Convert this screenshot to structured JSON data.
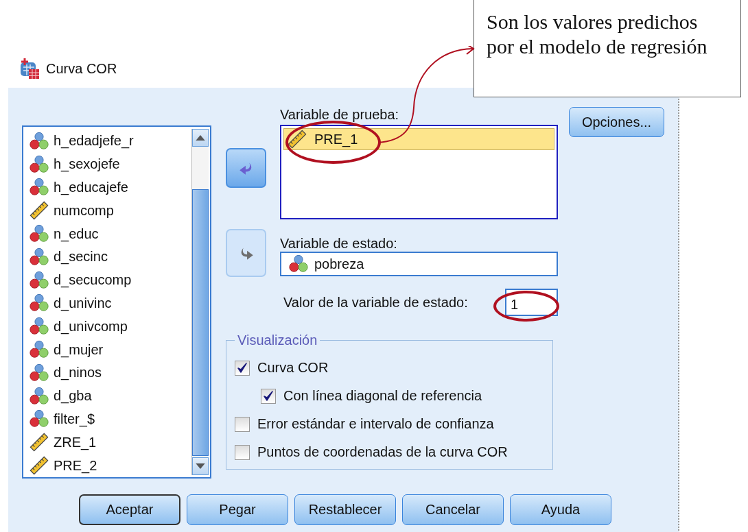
{
  "window": {
    "title": "Curva COR"
  },
  "annotation": {
    "text": "Son los valores predichos por el modelo de regresión"
  },
  "variables": [
    {
      "name": "h_edadjefe_r",
      "kind": "nominal"
    },
    {
      "name": "h_sexojefe",
      "kind": "nominal"
    },
    {
      "name": "h_educajefe",
      "kind": "nominal"
    },
    {
      "name": "numcomp",
      "kind": "scale"
    },
    {
      "name": "n_educ",
      "kind": "nominal"
    },
    {
      "name": "d_secinc",
      "kind": "nominal"
    },
    {
      "name": "d_secucomp",
      "kind": "nominal"
    },
    {
      "name": "d_univinc",
      "kind": "nominal"
    },
    {
      "name": "d_univcomp",
      "kind": "nominal"
    },
    {
      "name": "d_mujer",
      "kind": "nominal"
    },
    {
      "name": "d_ninos",
      "kind": "nominal"
    },
    {
      "name": "d_gba",
      "kind": "nominal"
    },
    {
      "name": "filter_$",
      "kind": "nominal"
    },
    {
      "name": "ZRE_1",
      "kind": "scale"
    },
    {
      "name": "PRE_2",
      "kind": "scale"
    }
  ],
  "move_buttons": [
    {
      "disabled": false
    },
    {
      "disabled": true
    }
  ],
  "test_variable": {
    "label": "Variable de prueba:",
    "items": [
      {
        "name": "PRE_1",
        "kind": "scale",
        "selected": true
      }
    ]
  },
  "state_variable": {
    "label": "Variable de estado:",
    "value": {
      "name": "pobreza",
      "kind": "nominal"
    }
  },
  "state_value": {
    "label": "Valor de la variable de estado:",
    "value": "1"
  },
  "options_button": "Opciones...",
  "display": {
    "title": "Visualización",
    "options": [
      {
        "label": "Curva COR",
        "checked": true,
        "children": [
          {
            "label": "Con línea diagonal de referencia",
            "checked": true
          }
        ]
      },
      {
        "label": "Error estándar e intervalo de confianza",
        "checked": false
      },
      {
        "label": "Puntos de coordenadas de la curva COR",
        "checked": false
      }
    ]
  },
  "buttons": [
    {
      "label": "Aceptar",
      "default": true
    },
    {
      "label": "Pegar",
      "default": false
    },
    {
      "label": "Restablecer",
      "default": false
    },
    {
      "label": "Cancelar",
      "default": false
    },
    {
      "label": "Ayuda",
      "default": false
    }
  ]
}
